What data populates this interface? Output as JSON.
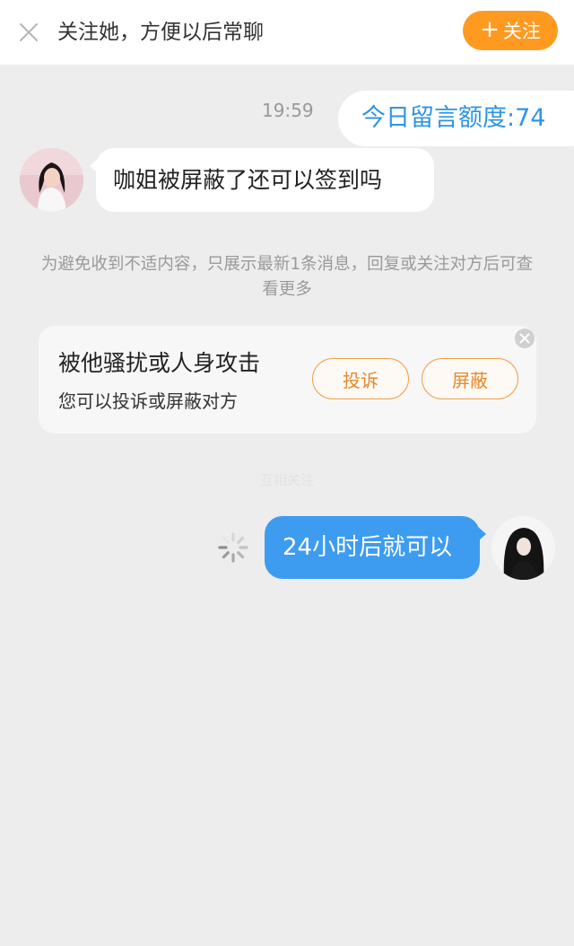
{
  "header": {
    "title": "关注她，方便以后常聊",
    "follow_label": "关注",
    "follow_color": "#ff9a21",
    "close_icon": "close-icon"
  },
  "chat": {
    "timestamp": "19:59",
    "quota_text": "今日留言额度:74",
    "incoming_message": "咖姐被屏蔽了还可以签到吗",
    "notice": "为避免收到不适内容，只展示最新1条消息，回复或关注对方后可查看更多",
    "faint_label": "互相关注",
    "outgoing_message": "24小时后就可以",
    "outgoing_color": "#3d9cf0"
  },
  "report_card": {
    "title": "被他骚扰或人身攻击",
    "subtitle": "您可以投诉或屏蔽对方",
    "complain_label": "投诉",
    "block_label": "屏蔽",
    "accent_color": "#e8882c"
  }
}
